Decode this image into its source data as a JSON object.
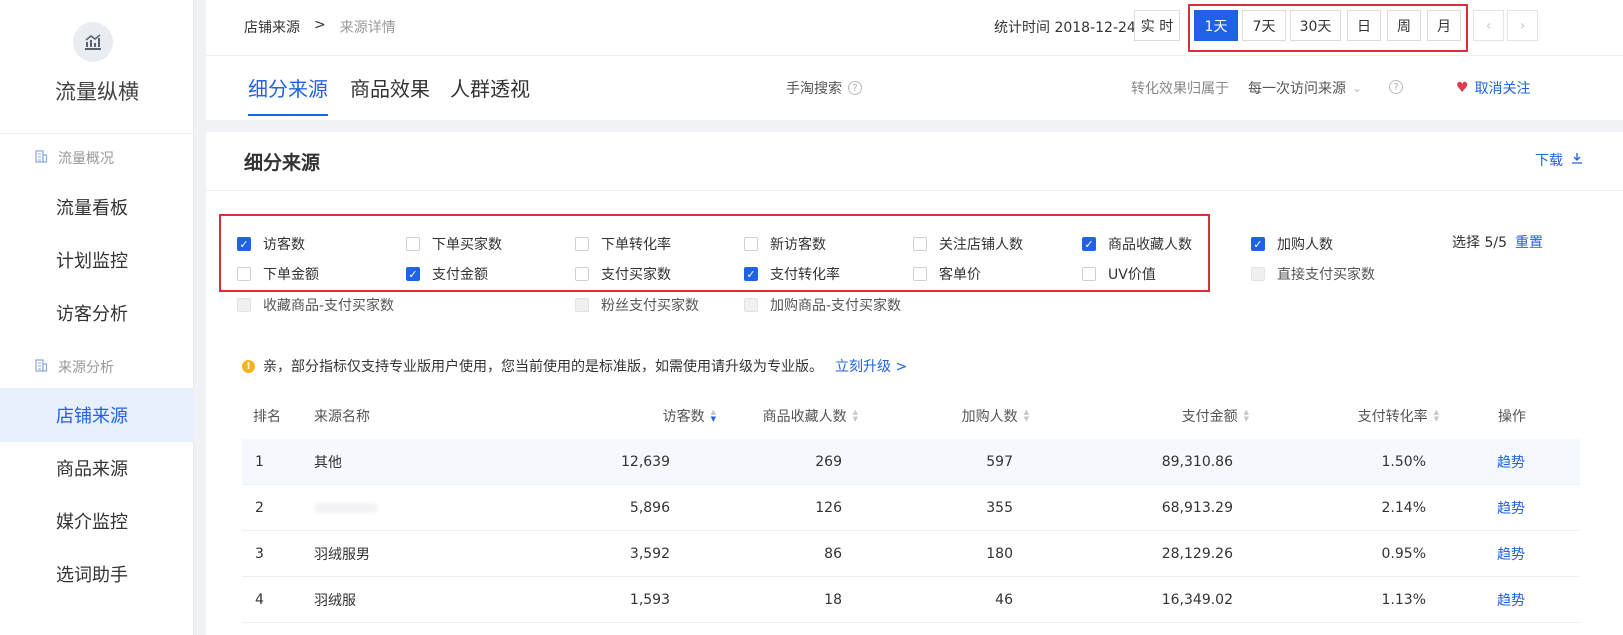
{
  "sidebar": {
    "brand": "流量纵横",
    "groups": [
      {
        "label": "流量概况",
        "items": [
          "流量看板",
          "计划监控",
          "访客分析"
        ]
      },
      {
        "label": "来源分析",
        "items": [
          "店铺来源",
          "商品来源",
          "媒介监控",
          "选词助手"
        ]
      }
    ],
    "active_item": "店铺来源"
  },
  "topbar": {
    "breadcrumb": {
      "parent": "店铺来源",
      "separator": ">",
      "current": "来源详情"
    },
    "stat_time_label": "统计时间 2018-12-24",
    "periods": [
      "实 时",
      "1天",
      "7天",
      "30天",
      "日",
      "周",
      "月"
    ],
    "selected_period": "1天",
    "prev_arrow": "‹",
    "next_arrow": "›"
  },
  "tabs": {
    "items": [
      "细分来源",
      "商品效果",
      "人群透视"
    ],
    "active": "细分来源",
    "search_label": "手淘搜索",
    "attribution_label": "转化效果归属于",
    "attribution_value": "每一次访问来源",
    "unfollow_label": "取消关注"
  },
  "panel": {
    "title": "细分来源",
    "download_label": "下载",
    "metrics": [
      {
        "label": "访客数",
        "checked": true,
        "disabled": false
      },
      {
        "label": "下单买家数",
        "checked": false,
        "disabled": false
      },
      {
        "label": "下单转化率",
        "checked": false,
        "disabled": false
      },
      {
        "label": "新访客数",
        "checked": false,
        "disabled": false
      },
      {
        "label": "关注店铺人数",
        "checked": false,
        "disabled": false
      },
      {
        "label": "商品收藏人数",
        "checked": true,
        "disabled": false
      },
      {
        "label": "加购人数",
        "checked": true,
        "disabled": false
      },
      {
        "label": "下单金额",
        "checked": false,
        "disabled": false
      },
      {
        "label": "支付金额",
        "checked": true,
        "disabled": false
      },
      {
        "label": "支付买家数",
        "checked": false,
        "disabled": false
      },
      {
        "label": "支付转化率",
        "checked": true,
        "disabled": false
      },
      {
        "label": "客单价",
        "checked": false,
        "disabled": false
      },
      {
        "label": "UV价值",
        "checked": false,
        "disabled": false
      },
      {
        "label": "直接支付买家数",
        "checked": false,
        "disabled": true
      },
      {
        "label": "收藏商品-支付买家数",
        "checked": false,
        "disabled": true
      },
      {
        "label": "粉丝支付买家数",
        "checked": false,
        "disabled": true
      },
      {
        "label": "加购商品-支付买家数",
        "checked": false,
        "disabled": true
      }
    ],
    "selection_label": "选择 5/5",
    "reset_label": "重置",
    "notice": "亲，部分指标仅支持专业版用户使用，您当前使用的是标准版，如需使用请升级为专业版。",
    "upgrade_link": "立刻升级 >"
  },
  "table": {
    "headers": [
      "排名",
      "来源名称",
      "访客数",
      "商品收藏人数",
      "加购人数",
      "支付金额",
      "支付转化率",
      "操作"
    ],
    "rows": [
      {
        "rank": "1",
        "name": "其他",
        "visitors": "12,639",
        "favorites": "269",
        "cart": "597",
        "pay_amount": "89,310.86",
        "pay_rate": "1.50%",
        "action": "趋势"
      },
      {
        "rank": "2",
        "name": "",
        "visitors": "5,896",
        "favorites": "126",
        "cart": "355",
        "pay_amount": "68,913.29",
        "pay_rate": "2.14%",
        "action": "趋势"
      },
      {
        "rank": "3",
        "name": "羽绒服男",
        "visitors": "3,592",
        "favorites": "86",
        "cart": "180",
        "pay_amount": "28,129.26",
        "pay_rate": "0.95%",
        "action": "趋势"
      },
      {
        "rank": "4",
        "name": "羽绒服",
        "visitors": "1,593",
        "favorites": "18",
        "cart": "46",
        "pay_amount": "16,349.02",
        "pay_rate": "1.13%",
        "action": "趋势"
      }
    ]
  },
  "colors": {
    "accent": "#2062e6",
    "highlight_box": "#d5313d",
    "warning": "#f4b31e"
  }
}
